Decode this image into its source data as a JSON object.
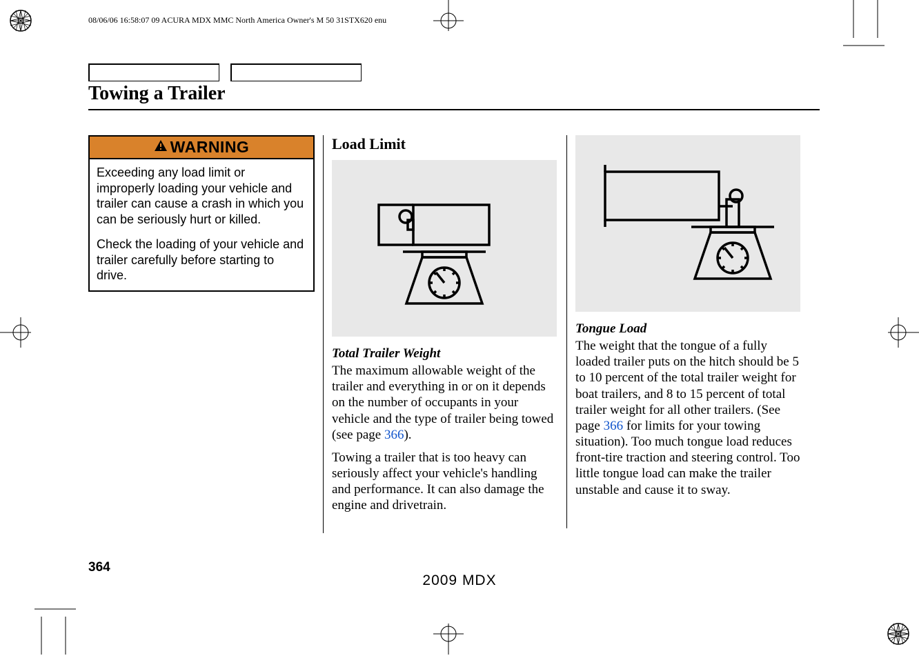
{
  "header": {
    "print_info": "08/06/06 16:58:07    09 ACURA MDX MMC North America Owner's M 50 31STX620 enu"
  },
  "section_title": "Towing a Trailer",
  "warning": {
    "label": "WARNING",
    "para1": "Exceeding any load limit or improperly loading your vehicle and trailer can cause a crash in which you can be seriously hurt or killed.",
    "para2": "Check the loading of your vehicle and trailer carefully before starting to drive."
  },
  "col2": {
    "heading": "Load Limit",
    "topic": "Total Trailer Weight",
    "para1_a": "The maximum allowable weight of the trailer and everything in or on it depends on the number of occupants in your vehicle and the type of trailer being towed (see page ",
    "para1_link": "366",
    "para1_b": ").",
    "para2": "Towing a trailer that is too heavy can seriously affect your vehicle's handling and performance. It can also damage the engine and drivetrain."
  },
  "col3": {
    "topic": "Tongue Load",
    "para1_a": "The weight that the tongue of a fully loaded trailer puts on the hitch should be 5 to 10 percent of the total trailer weight for boat trailers, and 8 to 15 percent of total trailer weight for all other trailers. (See page ",
    "para1_link": "366",
    "para1_b": " for limits for your towing situation). Too much tongue load reduces front-tire traction and steering control. Too little tongue load can make the trailer unstable and cause it to sway."
  },
  "footer": {
    "page_number": "364",
    "model": "2009  MDX"
  }
}
